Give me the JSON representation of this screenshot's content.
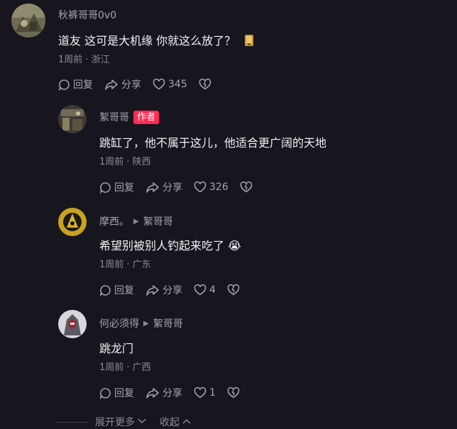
{
  "comments": [
    {
      "user": "秋裤哥哥0v0",
      "text": "道友 这可是大机缘 你就这么放了？",
      "time": "1周前 · 浙江",
      "reply_label": "回复",
      "share_label": "分享",
      "likes": "345"
    },
    {
      "user": "絮哥哥",
      "badge": "作者",
      "text": "跳缸了，他不属于这儿，他适合更广阔的天地",
      "time": "1周前 · 陕西",
      "reply_label": "回复",
      "share_label": "分享",
      "likes": "326"
    },
    {
      "user": "摩西。",
      "reply_to": "絮哥哥",
      "text": "希望别被别人钓起来吃了",
      "emoji": "😭",
      "time": "1周前 · 广东",
      "reply_label": "回复",
      "share_label": "分享",
      "likes": "4"
    },
    {
      "user": "何必须得",
      "reply_to": "絮哥哥",
      "text": "跳龙门",
      "time": "1周前 · 广西",
      "reply_label": "回复",
      "share_label": "分享",
      "likes": "1"
    }
  ],
  "footer": {
    "expand_label": "展开更多",
    "collapse_label": "收起"
  },
  "colors": {
    "background": "#17161e",
    "author_badge": "#fe2c55"
  },
  "icons": [
    "avatar",
    "sticker-icon",
    "reply-icon",
    "share-icon",
    "like-icon",
    "dislike-icon",
    "reply-arrow-icon",
    "crying-emoji",
    "chevron-down-icon",
    "chevron-up-icon"
  ]
}
